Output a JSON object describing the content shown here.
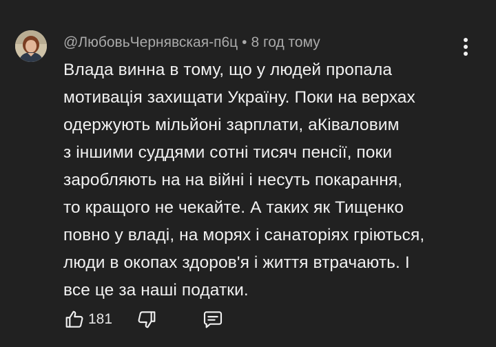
{
  "comment": {
    "author": "@ЛюбовьЧернявская-п6ц",
    "separator": "•",
    "time": "8 год тому",
    "text": "Влада винна в тому, що у людей пропала\nмотивація захищати Україну. Поки на верхах\nодержують мільйоні зарплати, аКіваловим\nз іншими суддями сотні тисяч пенсії, поки\nзаробляють на на війні і несуть покарання,\nто кращого не чекайте. А таких як Тищенко\nповно у владі, на морях і санаторіях гріються,\nлюди в окопах здоров'я і життя втрачають. І\nвсе це за наші податки.",
    "likes": "181"
  },
  "icons": {
    "menu": "more-vertical-icon",
    "like": "thumbs-up-icon",
    "dislike": "thumbs-down-icon",
    "reply": "reply-comment-icon"
  },
  "colors": {
    "background": "#212121",
    "text": "#f1f1f1",
    "meta": "#aaaaaa"
  }
}
